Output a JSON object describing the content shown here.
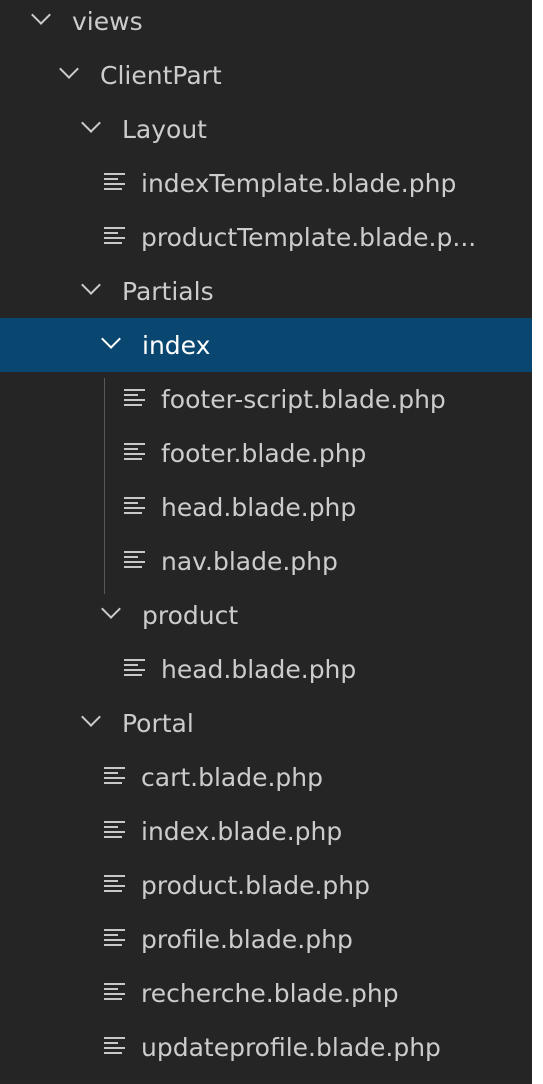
{
  "tree": [
    {
      "label": "views",
      "kind": "folder",
      "depth": 0
    },
    {
      "label": "ClientPart",
      "kind": "folder",
      "depth": 1
    },
    {
      "label": "Layout",
      "kind": "folder",
      "depth": 2
    },
    {
      "label": "indexTemplate.blade.php",
      "kind": "file",
      "depth": 2
    },
    {
      "label": "productTemplate.blade.p...",
      "kind": "file",
      "depth": 2
    },
    {
      "label": "Partials",
      "kind": "folder",
      "depth": 2
    },
    {
      "label": "index",
      "kind": "folder",
      "depth": 3,
      "selected": true
    },
    {
      "label": "footer-script.blade.php",
      "kind": "file",
      "depth": 3
    },
    {
      "label": "footer.blade.php",
      "kind": "file",
      "depth": 3
    },
    {
      "label": "head.blade.php",
      "kind": "file",
      "depth": 3
    },
    {
      "label": "nav.blade.php",
      "kind": "file",
      "depth": 3
    },
    {
      "label": "product",
      "kind": "folder",
      "depth": 3
    },
    {
      "label": "head.blade.php",
      "kind": "file",
      "depth": 3
    },
    {
      "label": "Portal",
      "kind": "folder",
      "depth": 2
    },
    {
      "label": "cart.blade.php",
      "kind": "file",
      "depth": 2
    },
    {
      "label": "index.blade.php",
      "kind": "file",
      "depth": 2
    },
    {
      "label": "product.blade.php",
      "kind": "file",
      "depth": 2
    },
    {
      "label": "profile.blade.php",
      "kind": "file",
      "depth": 2
    },
    {
      "label": "recherche.blade.php",
      "kind": "file",
      "depth": 2
    },
    {
      "label": "updateprofile.blade.php",
      "kind": "file",
      "depth": 2
    }
  ],
  "theme": {
    "background": "#252526",
    "text": "#cccccc",
    "selection": "#094771",
    "selected_text": "#ffffff"
  }
}
